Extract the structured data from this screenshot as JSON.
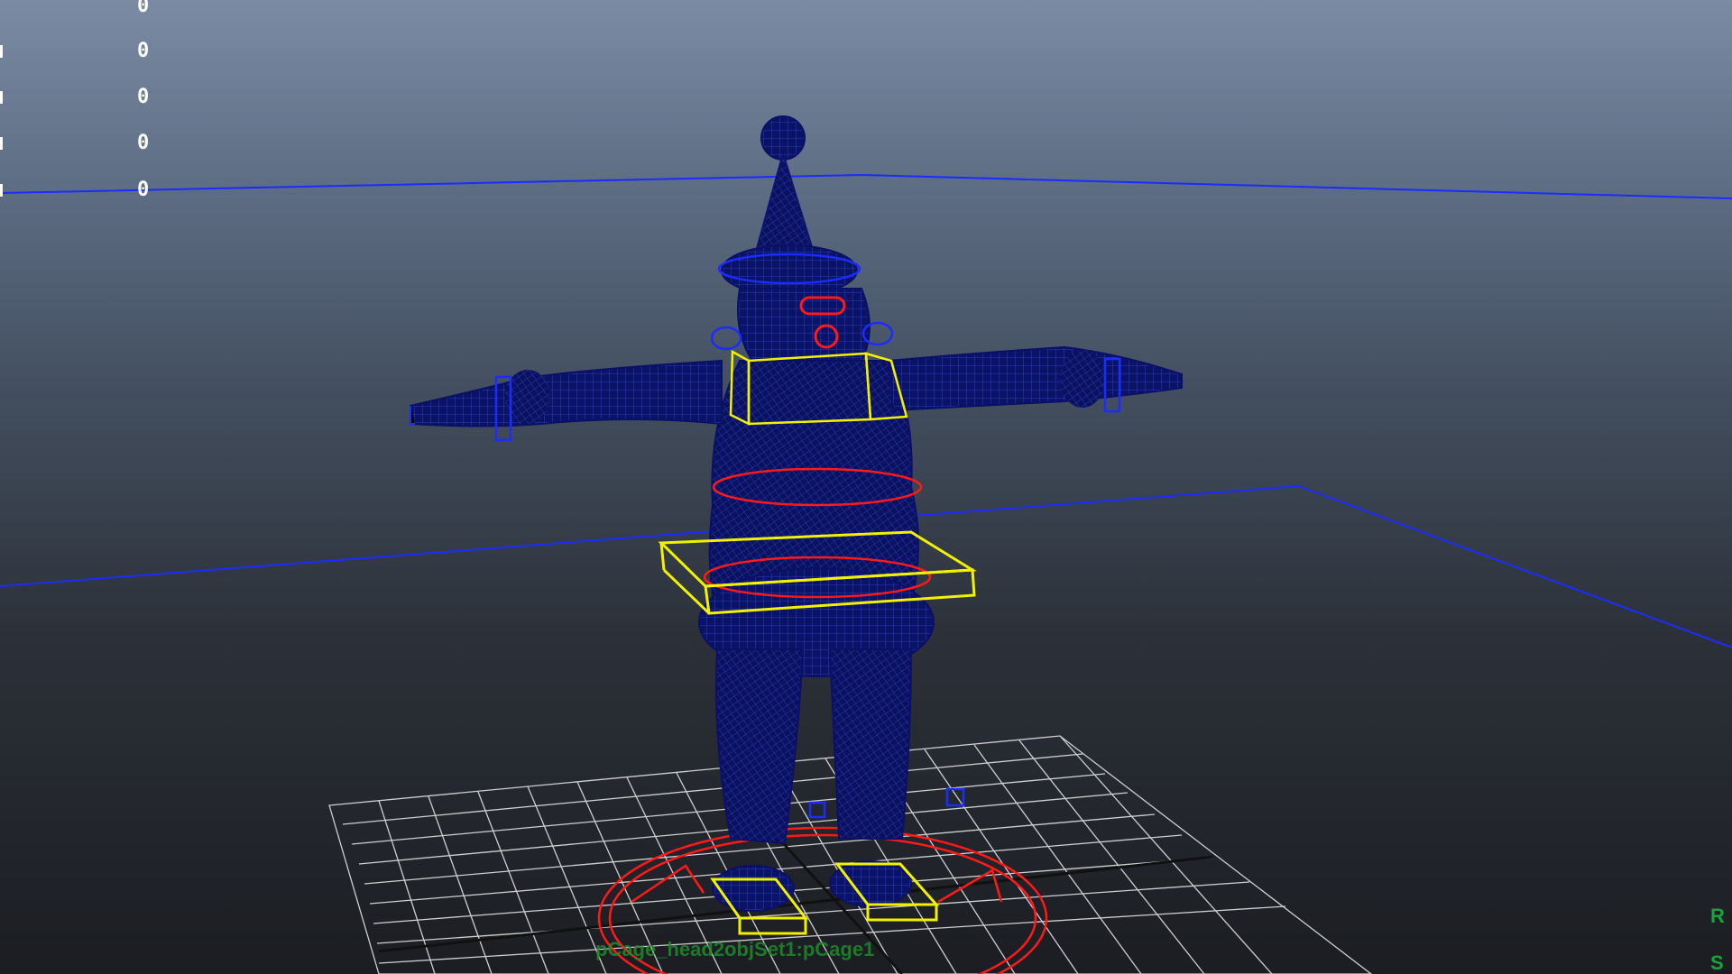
{
  "viewport": {
    "hud_values": [
      "0",
      "0",
      "0",
      "0",
      "0"
    ],
    "label": "pCage_head2objSet1:pCage1",
    "right_hud": [
      "R",
      "S"
    ]
  },
  "colors": {
    "background_top": "#7a8ba3",
    "background_bottom": "#1b1d22",
    "wireframe": "#0c1780",
    "selection_blue": "#1a2cff",
    "controller_yellow": "#f2f200",
    "controller_red": "#ff1a1a",
    "grid": "#d8d8d8",
    "hud_text": "#ffffff",
    "label_green": "#1f8a2a"
  },
  "icons": {
    "root_control": "red-circle-arrow-icon",
    "foot_control": "yellow-box-icon"
  }
}
